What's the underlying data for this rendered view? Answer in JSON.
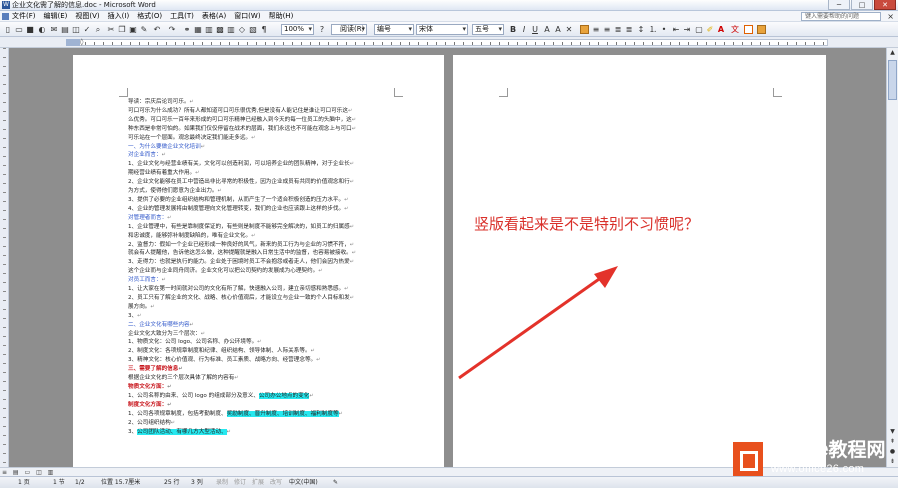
{
  "window": {
    "title": "企业文化需了解的信息.doc - Microsoft Word",
    "buttons": {
      "minimize": "─",
      "maximize": "□",
      "close": "✕"
    }
  },
  "menu": {
    "items": [
      "文件(F)",
      "编辑(E)",
      "视图(V)",
      "插入(I)",
      "格式(O)",
      "工具(T)",
      "表格(A)",
      "窗口(W)",
      "帮助(H)"
    ],
    "help_placeholder": "键入需要帮助的问题",
    "close_glyph": "×"
  },
  "toolbar": {
    "zoom": "100%",
    "reading_mode": "阅读(R)",
    "style": "编号",
    "font": "宋体",
    "size": "五号"
  },
  "document": {
    "page1_lines": [
      {
        "t": "导读：宗庆后论司可乐。",
        "c": ""
      },
      {
        "t": "可口可乐为什么成功？所有人都知道可口可乐很优秀,但是没有人能记住是谁让可口可乐这",
        "c": ""
      },
      {
        "t": "么优秀。可口可乐一百年来形成的可口可乐精神已经融入到今天的每一位员工的头脑中，这",
        "c": ""
      },
      {
        "t": "种东西是非常可怕的。如果我们仅仅停留在战术的层面，我们永远也不可能在观念上与可口",
        "c": ""
      },
      {
        "t": "可乐站在一个层面。观念最终决定我们能走多远。",
        "c": ""
      },
      {
        "t": "一、为什么要做企业文化培训",
        "c": "blue"
      },
      {
        "t": "对企业而言：",
        "c": "blue"
      },
      {
        "t": "1、企业文化与经营业绩有关，文化可以创造利润，可以培养企业的团队精神，对于企业长",
        "c": ""
      },
      {
        "t": "期经营业绩有着重大作用。",
        "c": ""
      },
      {
        "t": "2、企业文化能够在员工中营造出非比寻常的积极性，因为企业成员有共同的价值观念和行",
        "c": ""
      },
      {
        "t": "为方式，使得他们愿意为企业出力。",
        "c": ""
      },
      {
        "t": "3、提供了必要的企业组织结构和管理机制，从而产生了一个适合积极创造的压力水平。",
        "c": ""
      },
      {
        "t": "4、企业的管理发展将由制度管理向文化管理转变，我们的企业也应该跟上这样的步伐。",
        "c": ""
      },
      {
        "t": "对管理者而言：",
        "c": "blue"
      },
      {
        "t": "1、企业管理中，有些是靠制度保证的，有些则是制度不能够完全解决的，如员工的归属感",
        "c": ""
      },
      {
        "t": "和忠诚度，能够弥补制度缺陷的，唯有企业文化。",
        "c": ""
      },
      {
        "t": "2、监督力：假如一个企业已经形成一种良好的风气，新来的员工行为与企业的习惯不符，",
        "c": ""
      },
      {
        "t": "就会有人提醒他，告诉他这怎么做，这种提醒就是融入日常生活中的监督，也容易被接收。",
        "c": ""
      },
      {
        "t": "3、走得力：也就是执行的能力。企业处于困境时员工不会抱怨或者走人，他们会因为热爱",
        "c": ""
      },
      {
        "t": "这个企业而与企业同舟同济。企业文化可以把公司契约的发展成为心理契约。",
        "c": ""
      },
      {
        "t": "对员工而言：",
        "c": "blue"
      },
      {
        "t": "1、让大家在第一时间就对公司的文化有所了解，快速融入公司，建立亲切感和熟悉感。",
        "c": ""
      },
      {
        "t": "2、员工只有了解企业的文化、战略、核心价值观后，才能设立与企业一致的个人目标和发",
        "c": ""
      },
      {
        "t": "展方向。",
        "c": ""
      },
      {
        "t": "3、",
        "c": ""
      },
      {
        "t": "二、企业文化有哪些内容",
        "c": "blue"
      },
      {
        "t": "企业文化大致分为三个层次：",
        "c": ""
      },
      {
        "t": "1、物质文化：公司 logo、公司名称、办公环境等。",
        "c": ""
      },
      {
        "t": "2、制度文化：各项规章制度和纪律、组织结构、领导体制、人际关系等。",
        "c": ""
      },
      {
        "t": "3、精神文化：核心价值观、行为标准、员工素质、战略方向、经营理念等。",
        "c": ""
      },
      {
        "t": "三、需要了解的信息",
        "c": "red"
      },
      {
        "t": "根据企业文化的三个层次具体了解的内容有",
        "c": ""
      },
      {
        "t": "物质文化方面：",
        "c": "red"
      },
      {
        "t": "1、公司名称的由来、公司 logo 的组成部分及意义、",
        "c": "",
        "hl": "公司办公地点的变化"
      },
      {
        "t": "制度文化方面：",
        "c": "red"
      },
      {
        "t": "1、公司各项规章制度，包括考勤制度、",
        "c": "",
        "hl": "奖励制度、晋升制度、培训制度、福利制度等"
      },
      {
        "t": "2、公司组织结构",
        "c": ""
      },
      {
        "t": "3、",
        "c": "",
        "hl": "公司团队活动、有哪几方大型活动、"
      }
    ],
    "page2_mark": "↵"
  },
  "annotation": {
    "text": "竖版看起来是不是特别不习惯呢？",
    "color": "#d9302a"
  },
  "status": {
    "page": "1 页",
    "section": "1 节",
    "page_of": "1/2",
    "position": "位置 15.7厘米",
    "line": "25 行",
    "column": "3 列",
    "rec": "录制",
    "trk": "修订",
    "ext": "扩展",
    "ovr": "改写",
    "language": "中文(中国)"
  },
  "watermark": {
    "brand_en": "Office",
    "brand_cn": "教程网",
    "url": "www.office26.com"
  }
}
